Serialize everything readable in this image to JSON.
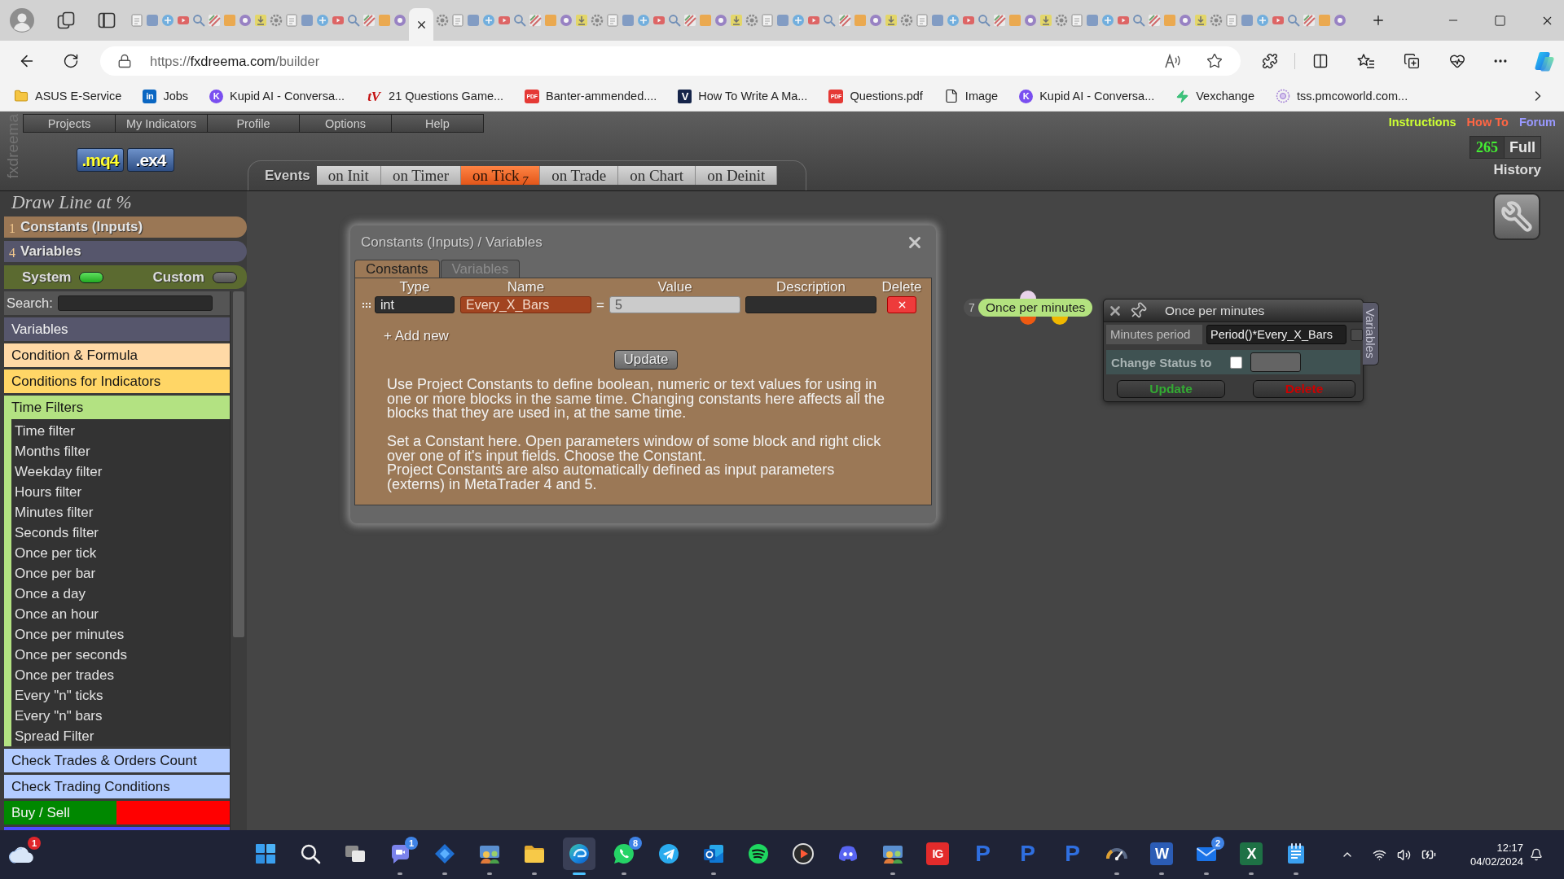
{
  "browser": {
    "tabs": [
      {
        "selected": false
      },
      {
        "selected": false
      },
      {
        "selected": false
      },
      {
        "selected": false
      },
      {
        "selected": false
      },
      {
        "selected": false
      },
      {
        "selected": false
      },
      {
        "selected": false
      },
      {
        "selected": false
      },
      {
        "selected": false
      },
      {
        "selected": false
      },
      {
        "selected": false
      },
      {
        "selected": false
      },
      {
        "selected": false
      },
      {
        "selected": false
      },
      {
        "selected": false
      },
      {
        "selected": false
      },
      {
        "selected": false
      },
      {
        "selected": true
      },
      {
        "selected": false
      },
      {
        "selected": false
      },
      {
        "selected": false
      },
      {
        "selected": false
      },
      {
        "selected": false
      },
      {
        "selected": false
      },
      {
        "selected": false
      },
      {
        "selected": false
      },
      {
        "selected": false
      },
      {
        "selected": false
      },
      {
        "selected": false
      },
      {
        "selected": false
      },
      {
        "selected": false
      },
      {
        "selected": false
      },
      {
        "selected": false
      },
      {
        "selected": false
      },
      {
        "selected": false
      },
      {
        "selected": false
      },
      {
        "selected": false
      },
      {
        "selected": false
      },
      {
        "selected": false
      },
      {
        "selected": false
      },
      {
        "selected": false
      },
      {
        "selected": false
      },
      {
        "selected": false
      },
      {
        "selected": false
      },
      {
        "selected": false
      },
      {
        "selected": false
      },
      {
        "selected": false
      },
      {
        "selected": false
      },
      {
        "selected": false
      },
      {
        "selected": false
      },
      {
        "selected": false
      },
      {
        "selected": false
      },
      {
        "selected": false
      },
      {
        "selected": false
      },
      {
        "selected": false
      },
      {
        "selected": false
      },
      {
        "selected": false
      },
      {
        "selected": false
      },
      {
        "selected": false
      },
      {
        "selected": false
      },
      {
        "selected": false
      },
      {
        "selected": false
      },
      {
        "selected": false
      },
      {
        "selected": false
      },
      {
        "selected": false
      },
      {
        "selected": false
      },
      {
        "selected": false
      },
      {
        "selected": false
      },
      {
        "selected": false
      },
      {
        "selected": false
      },
      {
        "selected": false
      },
      {
        "selected": false
      },
      {
        "selected": false
      },
      {
        "selected": false
      },
      {
        "selected": false
      },
      {
        "selected": false
      },
      {
        "selected": false
      }
    ],
    "url": {
      "scheme": "https://",
      "host": "fxdreema.com",
      "path": "/builder"
    },
    "bookmarks": [
      {
        "kind": "folder",
        "label": "ASUS E-Service"
      },
      {
        "kind": "square",
        "glyph": "in",
        "label": "Jobs"
      },
      {
        "kind": "circle",
        "glyph": "K",
        "label": "Kupid AI - Conversa..."
      },
      {
        "kind": "script",
        "glyph": "tV",
        "label": "21 Questions Game..."
      },
      {
        "kind": "pdf",
        "glyph": "PDF",
        "label": "Banter-ammended...."
      },
      {
        "kind": "tile",
        "glyph": "V",
        "label": "How To Write A Ma..."
      },
      {
        "kind": "pdf",
        "glyph": "PDF",
        "label": "Questions.pdf"
      },
      {
        "kind": "file",
        "label": "Image"
      },
      {
        "kind": "circle",
        "glyph": "K",
        "label": "Kupid AI - Conversa..."
      },
      {
        "kind": "bolt",
        "label": "Vexchange"
      },
      {
        "kind": "ring",
        "label": "tss.pmcoworld.com..."
      }
    ]
  },
  "app": {
    "logo": "fxdreema",
    "menu": [
      "Projects",
      "My Indicators",
      "Profile",
      "Options",
      "Help"
    ],
    "exports": [
      {
        "label": ".mq4",
        "kind": "source"
      },
      {
        "label": ".ex4",
        "kind": "compiled"
      }
    ],
    "events": {
      "label": "Events",
      "tabs": [
        {
          "label": "on Init",
          "selected": false
        },
        {
          "label": "on Timer",
          "selected": false
        },
        {
          "label": "on Tick",
          "count": "7",
          "selected": true
        },
        {
          "label": "on Trade",
          "selected": false
        },
        {
          "label": "on Chart",
          "selected": false
        },
        {
          "label": "on Deinit",
          "selected": false
        }
      ]
    },
    "links": [
      {
        "label": "Instructions",
        "color": "#ccff33"
      },
      {
        "label": "How To",
        "color": "#ff6644"
      },
      {
        "label": "Forum",
        "color": "#9999ff"
      }
    ],
    "history": {
      "count": "265",
      "mode": "Full",
      "label": "History"
    }
  },
  "sidebar": {
    "project_title": "Draw Line at %",
    "sections": [
      {
        "count": "1",
        "label": "Constants (Inputs)",
        "color": "#9a7755"
      },
      {
        "count": "4",
        "label": "Variables",
        "color": "#56566c"
      }
    ],
    "toggles": [
      {
        "label": "System",
        "on": true
      },
      {
        "label": "Custom",
        "on": false
      }
    ],
    "search": {
      "label": "Search:"
    },
    "categories": [
      {
        "label": "Variables",
        "color": "#56566c"
      },
      {
        "label": "Condition & Formula",
        "color": "#ffd9a6"
      },
      {
        "label": "Conditions for Indicators",
        "color": "#ffd666"
      },
      {
        "label": "Time Filters",
        "color": "#b3e282",
        "children": [
          {
            "label": "Time filter"
          },
          {
            "label": "Months filter"
          },
          {
            "label": "Weekday filter"
          },
          {
            "label": "Hours filter"
          },
          {
            "label": "Minutes filter"
          },
          {
            "label": "Seconds filter"
          },
          {
            "label": "Once per tick"
          },
          {
            "label": "Once per bar"
          },
          {
            "label": "Once a day"
          },
          {
            "label": "Once an hour"
          },
          {
            "label": "Once per minutes"
          },
          {
            "label": "Once per seconds"
          },
          {
            "label": "Once per trades"
          },
          {
            "label": "Every \"n\" ticks"
          },
          {
            "label": "Every \"n\" bars"
          },
          {
            "label": "Spread Filter"
          }
        ]
      },
      {
        "label": "Check Trades & Orders Count",
        "color": "#b3ccff"
      },
      {
        "label": "Check Trading Conditions",
        "color": "#b3ccff"
      },
      {
        "label": "Buy / Sell",
        "color": "#008800",
        "split": {
          "color": "#ff0000"
        }
      },
      {
        "color": "#4d4dff"
      }
    ]
  },
  "dialog": {
    "title": "Constants (Inputs) / Variables",
    "tabs": [
      {
        "label": "Constants",
        "selected": true
      },
      {
        "label": "Variables",
        "selected": false
      }
    ],
    "columns": [
      "Type",
      "Name",
      "Value",
      "Description",
      "Delete"
    ],
    "rows": [
      {
        "type": "int",
        "name": "Every_X_Bars",
        "operator": "=",
        "value": "5"
      }
    ],
    "add_label": "+ Add new",
    "update_label": "Update",
    "help": [
      [
        "Use Project Constants to define boolean, numeric or text values for using in one or more blocks in the same time. Changing constants here affects all the blocks that they are used in, at the same time."
      ],
      [
        "Set a Constant here. Open parameters window of some block and right click over one of it's input fields. Choose the Constant.",
        "Project Constants are also automatically defined as input parameters (externs) in MetaTrader 4 and 5."
      ]
    ]
  },
  "canvas": {
    "node": {
      "number": "7",
      "label": "Once per minutes"
    },
    "properties": {
      "title": "Once per minutes",
      "side_tab": "Variables",
      "fields": [
        {
          "label": "Minutes period",
          "value": "Period()*Every_X_Bars",
          "checked": false
        }
      ],
      "status": {
        "label": "Change Status to",
        "checked": false
      },
      "buttons": [
        {
          "label": "Update",
          "color": "#33aa33"
        },
        {
          "label": "Delete",
          "color": "#cc0000"
        }
      ]
    }
  },
  "taskbar": {
    "weather_badge": "1",
    "apps": [
      {
        "running": true,
        "selected": false,
        "badge": "1"
      },
      {
        "running": true,
        "selected": false
      },
      {
        "running": true,
        "selected": false
      },
      {
        "running": true,
        "selected": false
      },
      {
        "running": true,
        "selected": true
      },
      {
        "running": true,
        "selected": false,
        "badge": "8"
      },
      {
        "running": false,
        "selected": false
      },
      {
        "running": true,
        "selected": false
      },
      {
        "running": false,
        "selected": false
      },
      {
        "running": false,
        "selected": false
      },
      {
        "running": false,
        "selected": false
      },
      {
        "running": true,
        "selected": false
      },
      {
        "running": false,
        "selected": false,
        "glyph": "IG"
      },
      {
        "running": false,
        "selected": false,
        "glyph": "P"
      },
      {
        "running": false,
        "selected": false,
        "glyph": "P"
      },
      {
        "running": false,
        "selected": false,
        "glyph": "P"
      },
      {
        "running": true,
        "selected": false
      },
      {
        "running": true,
        "selected": false,
        "glyph": "W"
      },
      {
        "running": true,
        "selected": false,
        "badge": "2"
      },
      {
        "running": true,
        "selected": false,
        "glyph": "X"
      },
      {
        "running": true,
        "selected": false
      }
    ],
    "clock": {
      "time": "12:17",
      "date": "04/02/2024"
    }
  }
}
